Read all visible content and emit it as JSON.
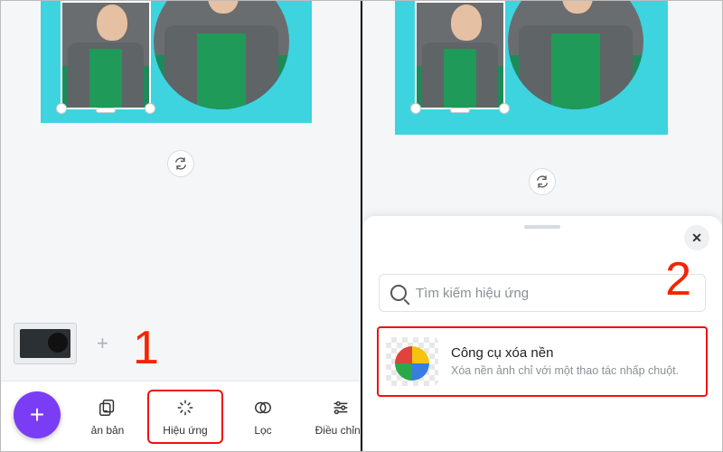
{
  "callouts": {
    "one": "1",
    "two": "2"
  },
  "canvas": {
    "bg": "#3dd4e0"
  },
  "sync_icon": "↻↺",
  "left": {
    "fab_label": "+",
    "add_page": "+",
    "tools": [
      {
        "icon": "copy",
        "label": "ản bản"
      },
      {
        "icon": "sparkle",
        "label": "Hiệu ứng"
      },
      {
        "icon": "overlap",
        "label": "Lọc"
      },
      {
        "icon": "sliders",
        "label": "Điều chỉnh"
      }
    ]
  },
  "right": {
    "close": "✕",
    "search_placeholder": "Tìm kiếm hiệu ứng",
    "effect": {
      "title": "Công cụ xóa nền",
      "desc": "Xóa nền ảnh chỉ với một thao tác nhấp chuột."
    }
  }
}
